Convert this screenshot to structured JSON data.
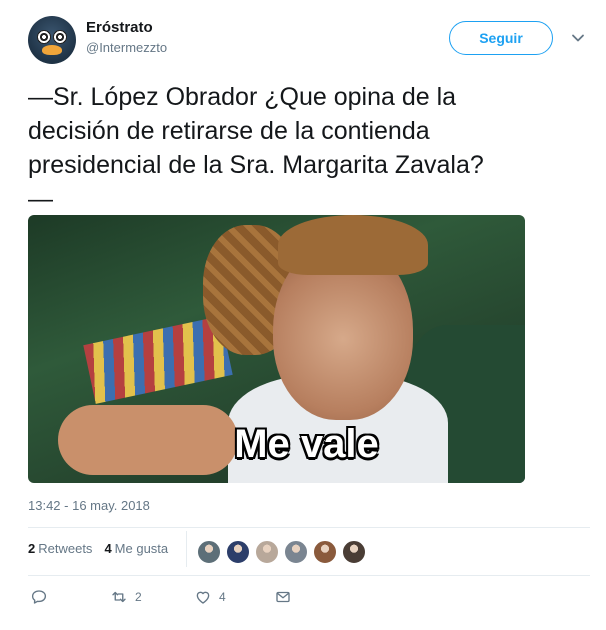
{
  "tweet": {
    "display_name": "Eróstrato",
    "handle": "@Intermezzto",
    "text": "—Sr. López Obrador ¿Que opina de la\ndecisión de retirarse de la contienda\npresidencial de la Sra. Margarita Zavala?\n—",
    "media_caption": "Me vale",
    "timestamp": "13:42 - 16 may. 2018"
  },
  "follow_button": {
    "label": "Seguir"
  },
  "stats": {
    "retweets_count": "2",
    "retweets_label": "Retweets",
    "likes_count": "4",
    "likes_label": "Me gusta"
  },
  "liker_avatars": [
    {
      "icon": "avatar",
      "color": "#5d6f78"
    },
    {
      "icon": "avatar",
      "color": "#2c3e6a"
    },
    {
      "icon": "avatar",
      "color": "#b8a89a"
    },
    {
      "icon": "avatar",
      "color": "#7a8591"
    },
    {
      "icon": "avatar",
      "color": "#8a5a3c"
    },
    {
      "icon": "avatar",
      "color": "#4a3d35"
    }
  ],
  "actions": {
    "reply": {
      "icon": "reply-icon",
      "count": ""
    },
    "retweet": {
      "icon": "retweet-icon",
      "count": "2"
    },
    "like": {
      "icon": "heart-icon",
      "count": "4"
    },
    "message": {
      "icon": "envelope-icon",
      "count": ""
    }
  },
  "colors": {
    "accent": "#1da1f2",
    "secondary_text": "#657786",
    "primary_text": "#14171a",
    "divider": "#e6ecf0"
  }
}
